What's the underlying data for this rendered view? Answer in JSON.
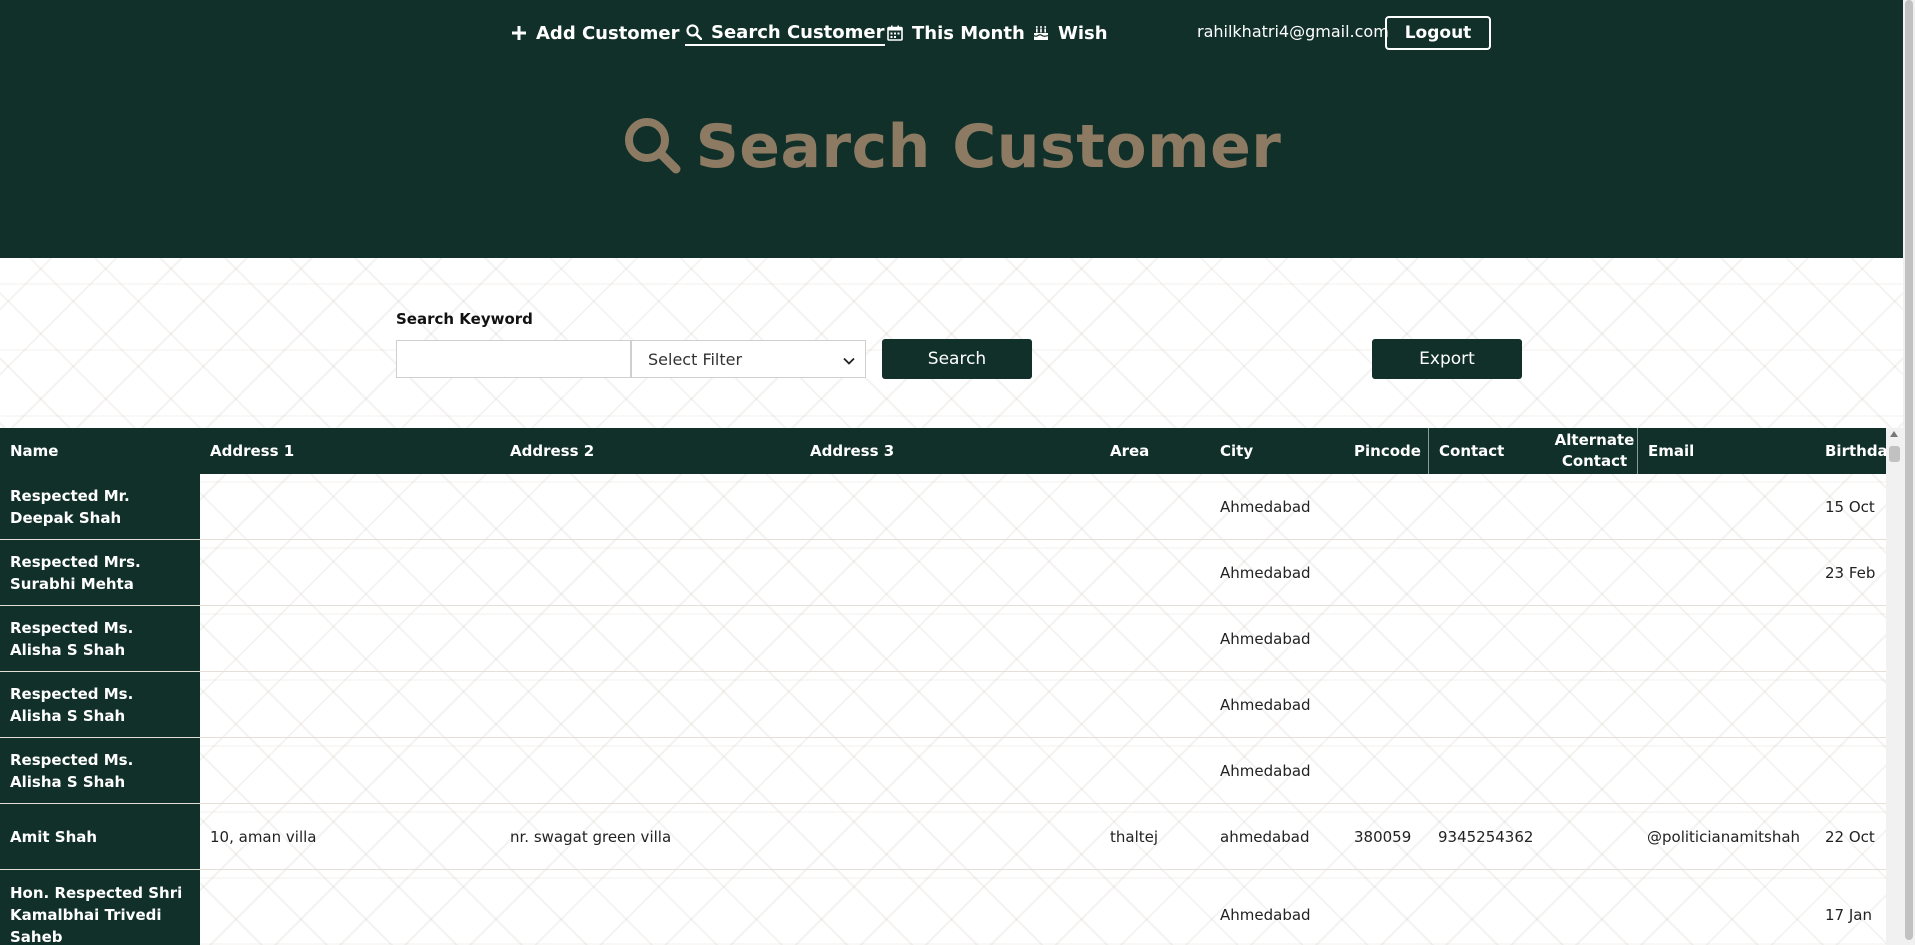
{
  "nav": {
    "items": [
      {
        "label": "Add Customer",
        "icon": "plus-icon"
      },
      {
        "label": "Search Customer",
        "icon": "search-icon",
        "active": true
      },
      {
        "label": "This Month",
        "icon": "calendar-icon"
      },
      {
        "label": "Wish",
        "icon": "birthday-cake-icon"
      }
    ],
    "user_email": "rahilkhatri4@gmail.com",
    "logout_label": "Logout"
  },
  "hero": {
    "title": "Search Customer",
    "icon": "search-icon"
  },
  "search": {
    "label": "Search Keyword",
    "keyword_value": "",
    "filter_selected": "Select Filter",
    "search_label": "Search",
    "export_label": "Export"
  },
  "table": {
    "columns": [
      "Name",
      "Address 1",
      "Address 2",
      "Address 3",
      "Area",
      "City",
      "Pincode",
      "Contact",
      "Alternate Contact",
      "Email",
      "Birthday"
    ],
    "rows": [
      {
        "name": "Respected Mr. Deepak Shah",
        "address1": "",
        "address2": "",
        "address3": "",
        "area": "",
        "city": "Ahmedabad",
        "pincode": "",
        "contact": "",
        "alt_contact": "",
        "email": "",
        "birthday": "15 Oct"
      },
      {
        "name": "Respected Mrs. Surabhi Mehta",
        "address1": "",
        "address2": "",
        "address3": "",
        "area": "",
        "city": "Ahmedabad",
        "pincode": "",
        "contact": "",
        "alt_contact": "",
        "email": "",
        "birthday": "23 Feb"
      },
      {
        "name": "Respected Ms. Alisha S Shah",
        "address1": "",
        "address2": "",
        "address3": "",
        "area": "",
        "city": "Ahmedabad",
        "pincode": "",
        "contact": "",
        "alt_contact": "",
        "email": "",
        "birthday": ""
      },
      {
        "name": "Respected Ms. Alisha S Shah",
        "address1": "",
        "address2": "",
        "address3": "",
        "area": "",
        "city": "Ahmedabad",
        "pincode": "",
        "contact": "",
        "alt_contact": "",
        "email": "",
        "birthday": ""
      },
      {
        "name": "Respected Ms. Alisha S Shah",
        "address1": "",
        "address2": "",
        "address3": "",
        "area": "",
        "city": "Ahmedabad",
        "pincode": "",
        "contact": "",
        "alt_contact": "",
        "email": "",
        "birthday": ""
      },
      {
        "name": "Amit Shah",
        "address1": "10, aman villa",
        "address2": "nr. swagat green villa",
        "address3": "",
        "area": "thaltej",
        "city": "ahmedabad",
        "pincode": "380059",
        "contact": "9345254362",
        "alt_contact": "",
        "email": "@politicianamitshah",
        "birthday": "22 Oct"
      },
      {
        "name": "Hon. Respected Shri Kamalbhai Trivedi Saheb",
        "address1": "",
        "address2": "",
        "address3": "",
        "area": "",
        "city": "Ahmedabad",
        "pincode": "",
        "contact": "",
        "alt_contact": "",
        "email": "",
        "birthday": "17 Jan"
      }
    ]
  }
}
